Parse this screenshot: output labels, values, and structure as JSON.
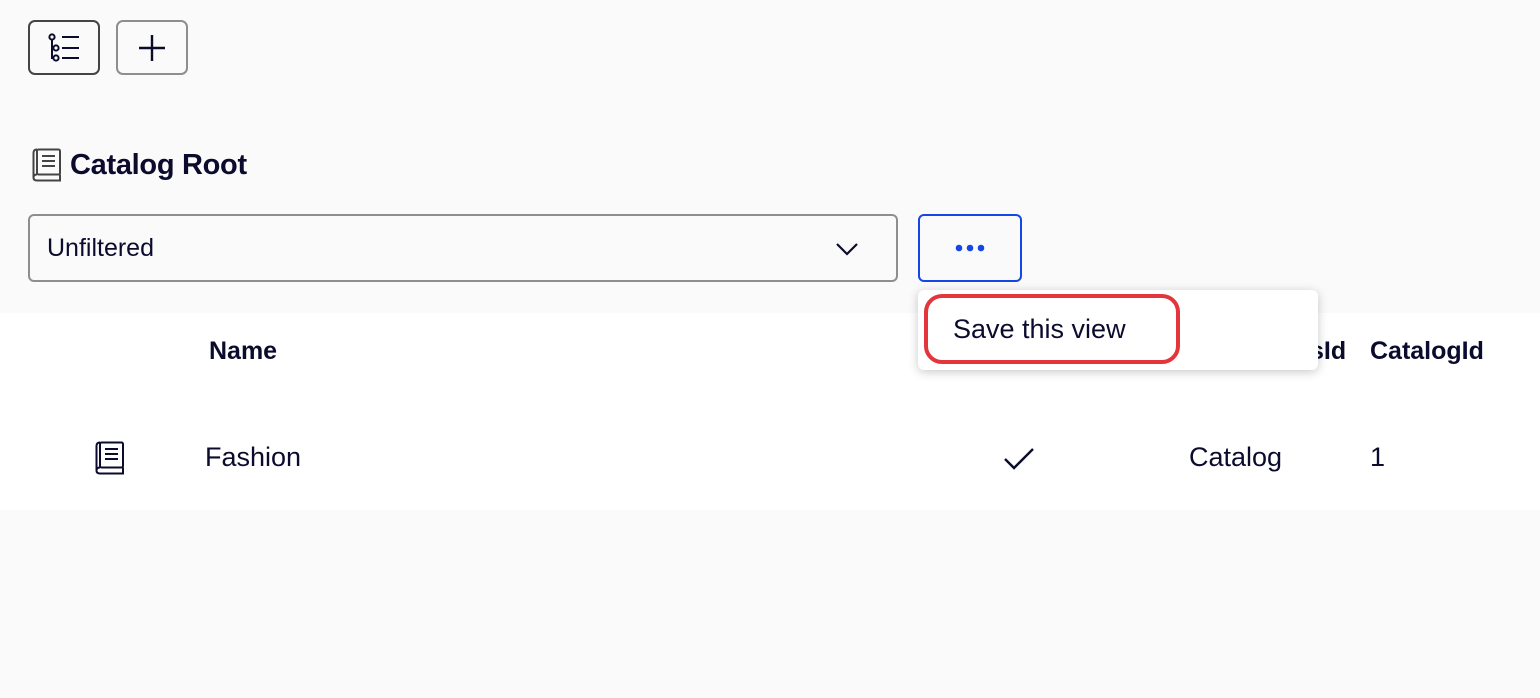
{
  "toolbar": {
    "tree_icon": "tree-list-icon",
    "add_icon": "plus-icon"
  },
  "header": {
    "icon": "catalog-book-icon",
    "title": "Catalog Root"
  },
  "filter": {
    "selected": "Unfiltered"
  },
  "more_button": {
    "icon": "ellipsis-icon"
  },
  "menu": {
    "items": [
      {
        "label": "Save this view"
      }
    ]
  },
  "table": {
    "columns": [
      "Name",
      "sId",
      "CatalogId"
    ],
    "rows": [
      {
        "icon": "catalog-book-icon",
        "name": "Fashion",
        "checked": true,
        "type": "Catalog",
        "catalog_id": "1"
      }
    ]
  },
  "colors": {
    "accent": "#1447e6",
    "highlight": "#e3353b",
    "text": "#0b0b2e"
  }
}
